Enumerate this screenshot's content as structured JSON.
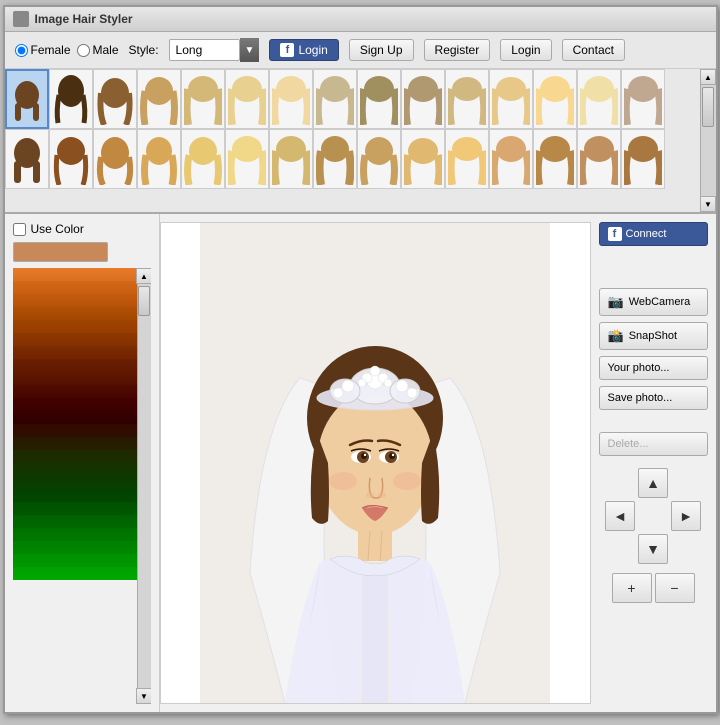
{
  "window": {
    "title": "Image Hair Styler"
  },
  "toolbar": {
    "gender_female_label": "Female",
    "gender_male_label": "Male",
    "style_label": "Style:",
    "style_value": "Long",
    "fb_login_label": "Login",
    "signup_label": "Sign Up",
    "register_label": "Register",
    "login_label": "Login",
    "contact_label": "Contact"
  },
  "color_panel": {
    "use_color_label": "Use Color",
    "swatches": [
      "#e8873a",
      "#d4752a",
      "#c8681a",
      "#c06018",
      "#b85515",
      "#b04c12",
      "#a8440f",
      "#a03c0c",
      "#983408",
      "#902c05",
      "#882402",
      "#801c00",
      "#781400",
      "#700c00",
      "#680400",
      "#600000",
      "#581000",
      "#501800",
      "#482000",
      "#402800",
      "#383000",
      "#303800",
      "#284000",
      "#204800"
    ]
  },
  "right_panel": {
    "fb_connect_label": "Connect",
    "webcamera_label": "WebCamera",
    "snapshot_label": "SnapShot",
    "your_photo_label": "Your photo...",
    "save_photo_label": "Save photo...",
    "delete_label": "Delete...",
    "nav_up": "▲",
    "nav_down": "▼",
    "nav_left": "◄",
    "nav_right": "►",
    "zoom_in": "+",
    "zoom_out": "−"
  },
  "hair_styles": [
    {
      "id": 1,
      "label": "Style 1",
      "selected": true
    },
    {
      "id": 2,
      "label": "Style 2",
      "selected": false
    },
    {
      "id": 3,
      "label": "Style 3",
      "selected": false
    },
    {
      "id": 4,
      "label": "Style 4",
      "selected": false
    },
    {
      "id": 5,
      "label": "Style 5",
      "selected": false
    },
    {
      "id": 6,
      "label": "Style 6",
      "selected": false
    },
    {
      "id": 7,
      "label": "Style 7",
      "selected": false
    },
    {
      "id": 8,
      "label": "Style 8",
      "selected": false
    },
    {
      "id": 9,
      "label": "Style 9",
      "selected": false
    },
    {
      "id": 10,
      "label": "Style 10",
      "selected": false
    },
    {
      "id": 11,
      "label": "Style 11",
      "selected": false
    },
    {
      "id": 12,
      "label": "Style 12",
      "selected": false
    },
    {
      "id": 13,
      "label": "Style 13",
      "selected": false
    },
    {
      "id": 14,
      "label": "Style 14",
      "selected": false
    },
    {
      "id": 15,
      "label": "Style 15",
      "selected": false
    },
    {
      "id": 16,
      "label": "Style 16",
      "selected": false
    },
    {
      "id": 17,
      "label": "Style 17",
      "selected": false
    },
    {
      "id": 18,
      "label": "Style 18",
      "selected": false
    },
    {
      "id": 19,
      "label": "Style 19",
      "selected": false
    },
    {
      "id": 20,
      "label": "Style 20",
      "selected": false
    },
    {
      "id": 21,
      "label": "Style 21",
      "selected": false
    },
    {
      "id": 22,
      "label": "Style 22",
      "selected": false
    },
    {
      "id": 23,
      "label": "Style 23",
      "selected": false
    },
    {
      "id": 24,
      "label": "Style 24",
      "selected": false
    },
    {
      "id": 25,
      "label": "Style 25",
      "selected": false
    },
    {
      "id": 26,
      "label": "Style 26",
      "selected": false
    },
    {
      "id": 27,
      "label": "Style 27",
      "selected": false
    },
    {
      "id": 28,
      "label": "Style 28",
      "selected": false
    },
    {
      "id": 29,
      "label": "Style 29",
      "selected": false
    },
    {
      "id": 30,
      "label": "Style 30",
      "selected": false
    }
  ]
}
